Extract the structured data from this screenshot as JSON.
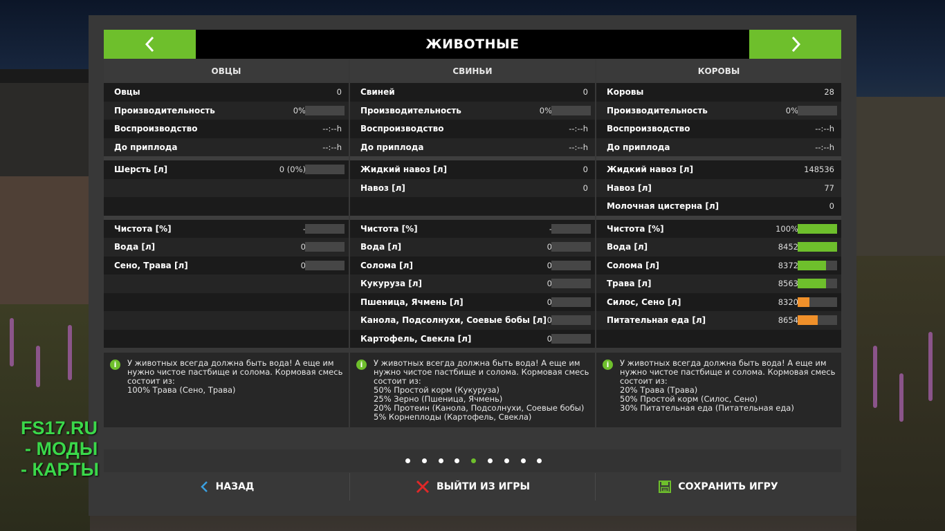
{
  "header": {
    "title": "ЖИВОТНЫЕ"
  },
  "columns": [
    {
      "title": "ОВЦЫ",
      "group1": [
        {
          "label": "Овцы",
          "value": "0"
        },
        {
          "label": "Производительность",
          "value": "0%",
          "bar": 0,
          "barColor": "#6ebf2c"
        },
        {
          "label": "Воспроизводство",
          "value": "--:--h"
        },
        {
          "label": "До приплода",
          "value": "--:--h"
        }
      ],
      "group2": [
        {
          "label": "Шерсть [л]",
          "value": "0 (0%)",
          "bar": 0,
          "barColor": "#6ebf2c"
        },
        {
          "label": "",
          "value": ""
        },
        {
          "label": "",
          "value": ""
        }
      ],
      "group3": [
        {
          "label": "Чистота [%]",
          "value": "-",
          "bar": 0,
          "barColor": "#6ebf2c"
        },
        {
          "label": "Вода [л]",
          "value": "0",
          "bar": 0,
          "barColor": "#6ebf2c"
        },
        {
          "label": "Сено, Трава [л]",
          "value": "0",
          "bar": 0,
          "barColor": "#6ebf2c"
        },
        {
          "label": "",
          "value": ""
        },
        {
          "label": "",
          "value": ""
        },
        {
          "label": "",
          "value": ""
        },
        {
          "label": "",
          "value": ""
        }
      ],
      "info": "У животных всегда должна быть вода! А еще им нужно чистое пастбище и солома. Кормовая смесь состоит из:\n100% Трава (Сено, Трава)"
    },
    {
      "title": "СВИНЬИ",
      "group1": [
        {
          "label": "Свиней",
          "value": "0"
        },
        {
          "label": "Производительность",
          "value": "0%",
          "bar": 0,
          "barColor": "#6ebf2c"
        },
        {
          "label": "Воспроизводство",
          "value": "--:--h"
        },
        {
          "label": "До приплода",
          "value": "--:--h"
        }
      ],
      "group2": [
        {
          "label": "Жидкий навоз [л]",
          "value": "0"
        },
        {
          "label": "Навоз [л]",
          "value": "0"
        },
        {
          "label": "",
          "value": ""
        }
      ],
      "group3": [
        {
          "label": "Чистота [%]",
          "value": "-",
          "bar": 0,
          "barColor": "#6ebf2c"
        },
        {
          "label": "Вода [л]",
          "value": "0",
          "bar": 0,
          "barColor": "#6ebf2c"
        },
        {
          "label": "Солома [л]",
          "value": "0",
          "bar": 0,
          "barColor": "#6ebf2c"
        },
        {
          "label": "Кукуруза [л]",
          "value": "0",
          "bar": 0,
          "barColor": "#6ebf2c"
        },
        {
          "label": "Пшеница, Ячмень [л]",
          "value": "0",
          "bar": 0,
          "barColor": "#6ebf2c"
        },
        {
          "label": "Канола, Подсолнухи, Соевые бобы [л]",
          "value": "0",
          "bar": 0,
          "barColor": "#6ebf2c"
        },
        {
          "label": "Картофель, Свекла [л]",
          "value": "0",
          "bar": 0,
          "barColor": "#6ebf2c"
        }
      ],
      "info": "У животных всегда должна быть вода! А еще им нужно чистое пастбище и солома. Кормовая смесь состоит из:\n50% Простой корм (Кукуруза)\n25% Зерно (Пшеница, Ячмень)\n20% Протеин (Канола, Подсолнухи, Соевые бобы)\n5% Корнеплоды (Картофель, Свекла)"
    },
    {
      "title": "КОРОВЫ",
      "group1": [
        {
          "label": "Коровы",
          "value": "28"
        },
        {
          "label": "Производительность",
          "value": "0%",
          "bar": 0,
          "barColor": "#6ebf2c"
        },
        {
          "label": "Воспроизводство",
          "value": "--:--h"
        },
        {
          "label": "До приплода",
          "value": "--:--h"
        }
      ],
      "group2": [
        {
          "label": "Жидкий навоз [л]",
          "value": "148536"
        },
        {
          "label": "Навоз [л]",
          "value": "77"
        },
        {
          "label": "Молочная цистерна [л]",
          "value": "0"
        }
      ],
      "group3": [
        {
          "label": "Чистота [%]",
          "value": "100%",
          "bar": 1.0,
          "barColor": "#6ebf2c"
        },
        {
          "label": "Вода [л]",
          "value": "8452",
          "bar": 1.0,
          "barColor": "#6ebf2c"
        },
        {
          "label": "Солома [л]",
          "value": "8372",
          "bar": 0.72,
          "barColor": "#6ebf2c"
        },
        {
          "label": "Трава [л]",
          "value": "8563",
          "bar": 0.72,
          "barColor": "#6ebf2c"
        },
        {
          "label": "Силос, Сено [л]",
          "value": "8320",
          "bar": 0.3,
          "barColor": "#f0902a"
        },
        {
          "label": "Питательная еда [л]",
          "value": "8654",
          "bar": 0.5,
          "barColor": "#f0902a"
        },
        {
          "label": "",
          "value": ""
        }
      ],
      "info": "У животных всегда должна быть вода! А еще им нужно чистое пастбище и солома. Кормовая смесь состоит из:\n20% Трава (Трава)\n50% Простой корм (Силос, Сено)\n30% Питательная еда (Питательная еда)"
    }
  ],
  "pagination": {
    "count": 9,
    "active": 4
  },
  "footer": {
    "back": "НАЗАД",
    "quit": "ВЫЙТИ ИЗ ИГРЫ",
    "save": "СОХРАНИТЬ ИГРУ"
  },
  "watermark": [
    "FS17.RU",
    "- МОДЫ",
    "- КАРТЫ"
  ],
  "colors": {
    "accent": "#6ebf2c",
    "warning": "#f0902a",
    "quit": "#e02828",
    "back": "#3aa0e0"
  }
}
